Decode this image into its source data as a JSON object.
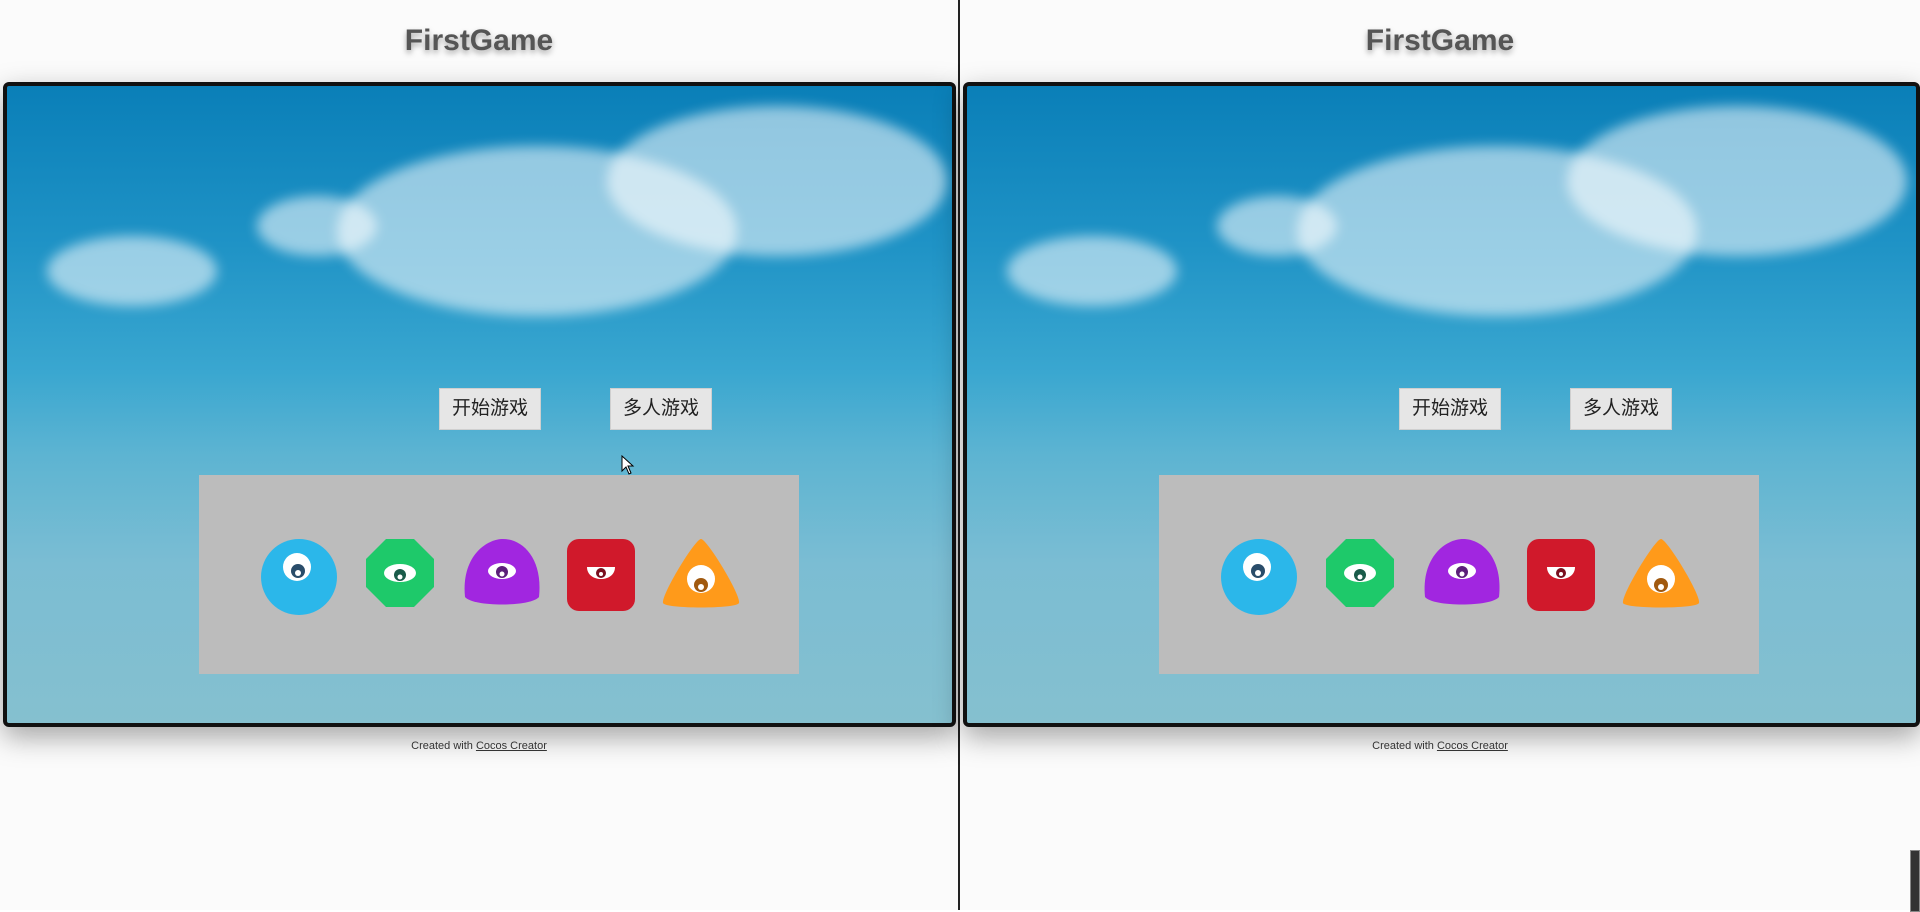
{
  "app_title": "FirstGame",
  "buttons": {
    "start": "开始游戏",
    "multiplayer": "多人游戏"
  },
  "characters": [
    {
      "name": "blue-circle-monster-icon",
      "color": "#2bb7ea"
    },
    {
      "name": "green-octagon-monster-icon",
      "color": "#1ec96a"
    },
    {
      "name": "purple-blob-monster-icon",
      "color": "#a126e0"
    },
    {
      "name": "red-square-monster-icon",
      "color": "#d0192b"
    },
    {
      "name": "orange-triangle-monster-icon",
      "color": "#ff9a1a"
    }
  ],
  "footer": {
    "prefix": "Created with ",
    "link": "Cocos Creator"
  },
  "colors": {
    "panel": "#bcbcbc",
    "sky_top": "#0a7fb8",
    "sky_bottom": "#85c0cf"
  }
}
